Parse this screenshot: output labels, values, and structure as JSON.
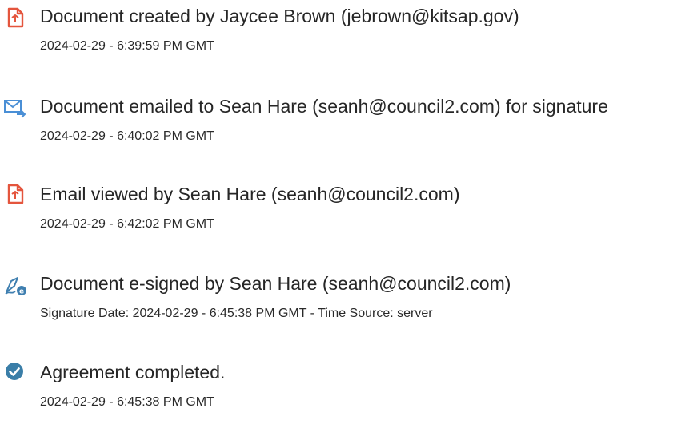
{
  "events": [
    {
      "icon": "document-icon",
      "text": "Document created by Jaycee Brown (jebrown@kitsap.gov)",
      "timestamp": "2024-02-29 - 6:39:59 PM GMT"
    },
    {
      "icon": "email-sent-icon",
      "text": "Document emailed to Sean Hare (seanh@council2.com) for signature",
      "timestamp": "2024-02-29 - 6:40:02 PM GMT"
    },
    {
      "icon": "document-icon",
      "text": "Email viewed by Sean Hare (seanh@council2.com)",
      "timestamp": "2024-02-29 - 6:42:02 PM GMT"
    },
    {
      "icon": "signature-pen-icon",
      "text": "Document e-signed by Sean Hare (seanh@council2.com)",
      "timestamp": "Signature Date: 2024-02-29 - 6:45:38 PM GMT - Time Source: server"
    },
    {
      "icon": "check-circle-icon",
      "text": "Agreement completed.",
      "timestamp": "2024-02-29 - 6:45:38 PM GMT"
    }
  ],
  "colors": {
    "document_icon": "#e4553d",
    "email_icon": "#4a8fd6",
    "signature_icon": "#3f7fb0",
    "check_icon": "#3a7ea8",
    "text": "#262626"
  }
}
